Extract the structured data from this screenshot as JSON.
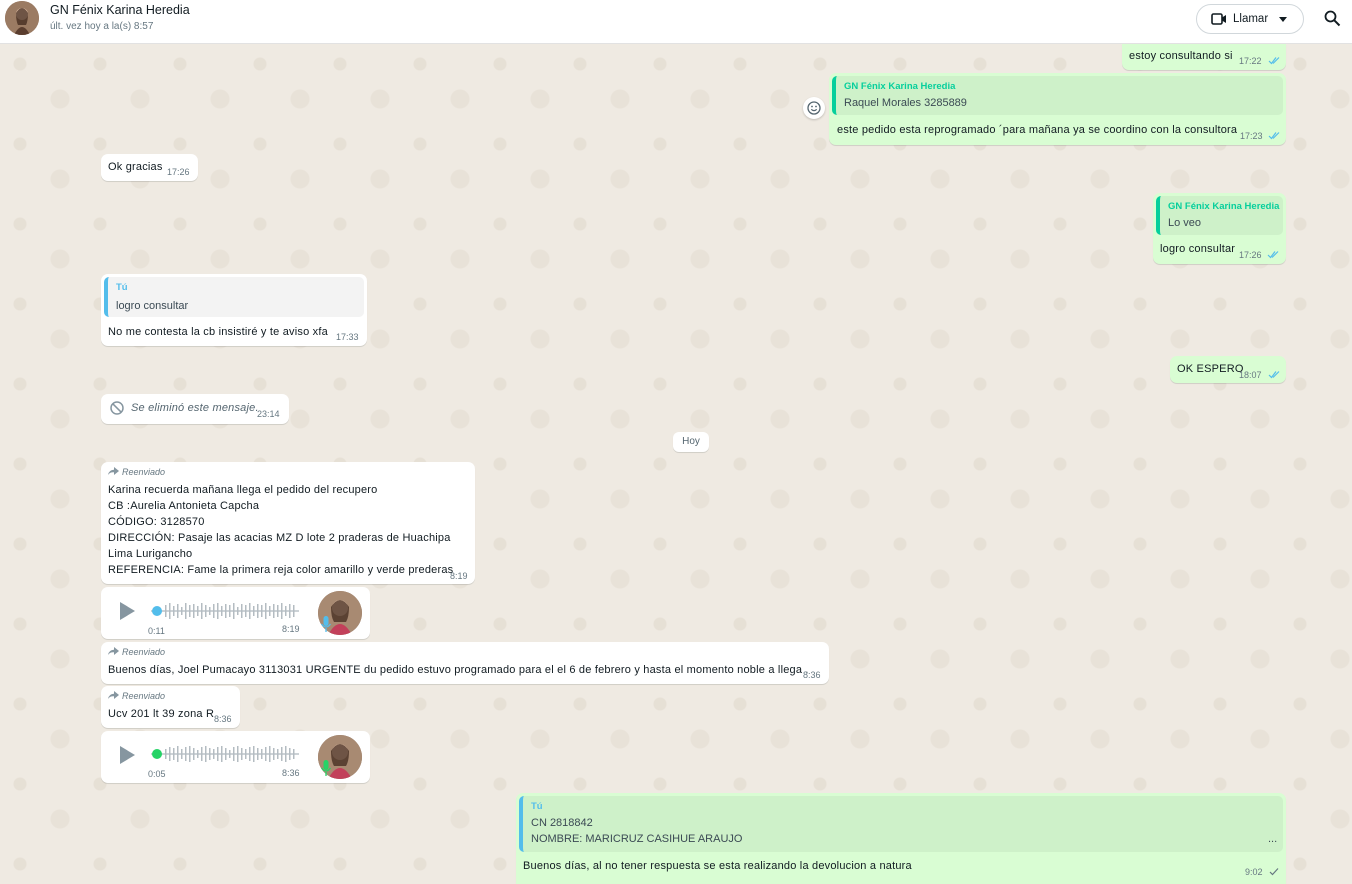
{
  "header": {
    "contact_name": "GN Fénix Karina Heredia",
    "status": "últ. vez hoy a la(s) 8:57",
    "call_label": "Llamar",
    "icons": {
      "call": "video-camera-icon",
      "caret": "chevron-down-icon",
      "search": "search-icon"
    }
  },
  "colors": {
    "incoming": "#ffffff",
    "outgoing": "#d9fdd3",
    "quote_other": "#06cf9c",
    "quote_self": "#53bdeb",
    "read_tick": "#53bdeb"
  },
  "messages": {
    "m1": {
      "text": "estoy consultando si",
      "time": "17:22"
    },
    "m2": {
      "quote_author": "GN Fénix Karina Heredia",
      "quote_text": "Raquel Morales 3285889",
      "text": "este pedido esta reprogramado ´para mañana ya se coordino con la consultora",
      "time": "17:23"
    },
    "m3": {
      "text": "Ok gracias",
      "time": "17:26"
    },
    "m4": {
      "quote_author": "GN Fénix Karina Heredia",
      "quote_text": "Lo veo",
      "text": "logro consultar",
      "time": "17:26"
    },
    "m5": {
      "quote_author": "Tú",
      "quote_text": "logro consultar",
      "text": "No me contesta la cb insistiré y te aviso xfa",
      "time": "17:33"
    },
    "m6": {
      "text": "OK ESPERO",
      "time": "18:07"
    },
    "m7": {
      "text": "Se eliminó este mensaje.",
      "time": "23:14"
    },
    "day_label": "Hoy",
    "m8": {
      "forwarded": "Reenviado",
      "lines": [
        "Karina recuerda mañana llega el pedido del recupero",
        "CB :Aurelia Antonieta Capcha",
        "CÓDIGO: 3128570",
        "DIRECCIÓN: Pasaje las acacias MZ D lote 2 praderas de Huachipa",
        "Lima Lurigancho",
        "REFERENCIA: Fame la primera reja color amarillo y verde prederas"
      ],
      "time": "8:19"
    },
    "m9": {
      "duration": "0:11",
      "time": "8:19"
    },
    "m10": {
      "forwarded": "Reenviado",
      "text": "Buenos días, Joel Pumacayo 3113031 URGENTE du pedido estuvo programado para el el 6 de febrero y hasta el momento noble a llega .",
      "time": "8:36"
    },
    "m11": {
      "forwarded": "Reenviado",
      "text": "Ucv 201 lt 39 zona R",
      "time": "8:36"
    },
    "m12": {
      "duration": "0:05",
      "time": "8:36"
    },
    "m13": {
      "quote_author": "Tú",
      "quote_lines": [
        "CN 2818842",
        "NOMBRE: MARICRUZ CASIHUE ARAUJO"
      ],
      "quote_more": "...",
      "text": "Buenos días, al no tener respuesta se esta realizando la devolucion a natura",
      "time": "9:02"
    }
  }
}
